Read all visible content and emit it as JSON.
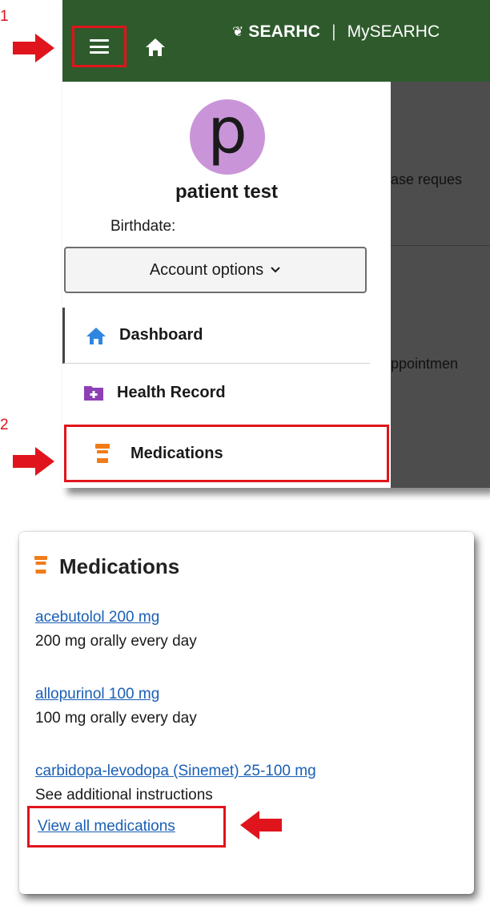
{
  "colors": {
    "header_bg": "#2e5a2c",
    "highlight": "#e0141c",
    "link": "#1a5fb4",
    "avatar_bg": "#c995d8",
    "dashboard_icon": "#2f86e0",
    "health_icon": "#8e3fb6",
    "medication_icon": "#f07c1a"
  },
  "annotations": {
    "step1": "1",
    "step2": "2"
  },
  "header": {
    "menu_icon": "hamburger-menu-icon",
    "home_icon": "home-icon",
    "brand_primary": "SEARHC",
    "brand_separator": "|",
    "brand_secondary": "MySEARHC"
  },
  "background": {
    "text1": "ase reques",
    "text2": "ppointmen"
  },
  "sidebar": {
    "avatar_initial": "p",
    "patient_name": "patient test",
    "birthdate_label": "Birthdate:",
    "account_button": "Account options",
    "items": [
      {
        "label": "Dashboard",
        "icon": "home-icon"
      },
      {
        "label": "Health Record",
        "icon": "folder-plus-icon"
      },
      {
        "label": "Medications",
        "icon": "pill-bottle-icon"
      }
    ]
  },
  "medications_card": {
    "title": "Medications",
    "icon": "pill-bottle-icon",
    "items": [
      {
        "name": "acebutolol 200 mg",
        "instructions": "200 mg orally every day"
      },
      {
        "name": "allopurinol 100 mg",
        "instructions": "100 mg orally every day"
      },
      {
        "name": "carbidopa-levodopa (Sinemet) 25-100 mg",
        "instructions": "See additional instructions"
      }
    ],
    "view_all_label": "View all medications"
  }
}
